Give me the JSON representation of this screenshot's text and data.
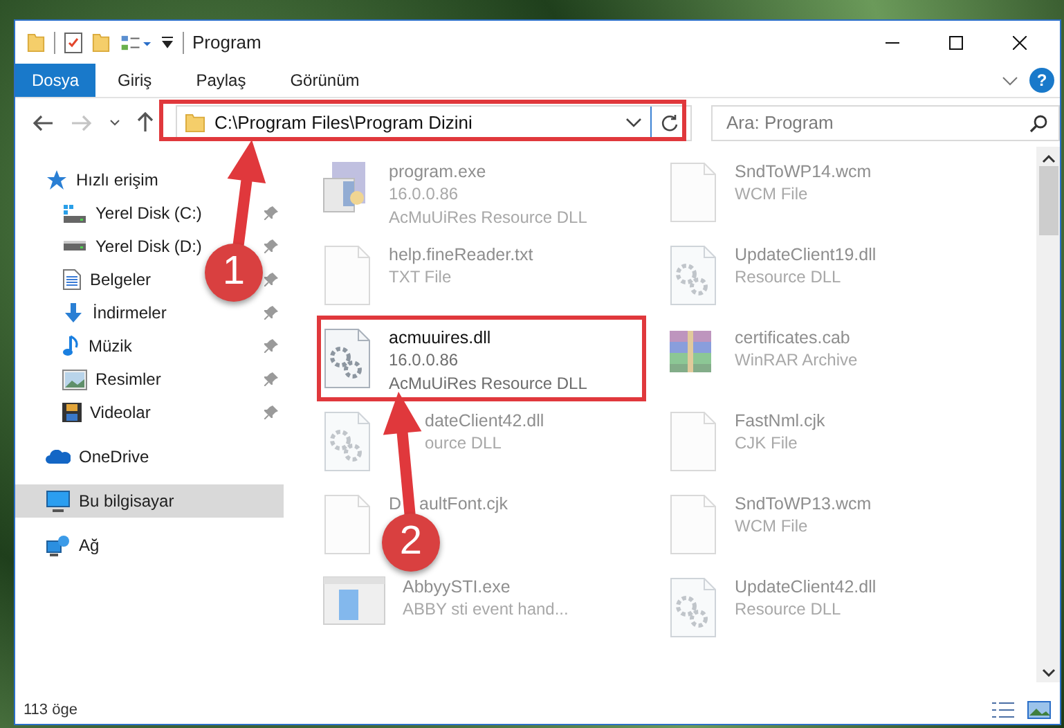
{
  "window": {
    "title": "Program"
  },
  "ribbon": {
    "tabs": [
      {
        "label": "Dosya",
        "kind": "file"
      },
      {
        "label": "Giriş",
        "kind": "tab"
      },
      {
        "label": "Paylaş",
        "kind": "tab"
      },
      {
        "label": "Görünüm",
        "kind": "tab"
      }
    ],
    "help": "?"
  },
  "navigation": {
    "forward": {
      "disabled": true
    }
  },
  "address": {
    "path": "C:\\Program Files\\Program Dizini"
  },
  "search": {
    "placeholder": "Ara: Program"
  },
  "sidebar": {
    "items": [
      {
        "label": "Hızlı erişim",
        "selected": false,
        "children": [
          {
            "label": "Yerel Disk (C:)",
            "pinned": true,
            "selected": false
          },
          {
            "label": "Yerel Disk (D:)",
            "pinned": true,
            "selected": false
          },
          {
            "label": "Belgeler",
            "pinned": true,
            "selected": false
          },
          {
            "label": "İndirmeler",
            "pinned": true,
            "selected": false
          },
          {
            "label": "Müzik",
            "pinned": true,
            "selected": false
          },
          {
            "label": "Resimler",
            "pinned": true,
            "selected": false
          },
          {
            "label": "Videolar",
            "pinned": true,
            "selected": false
          }
        ]
      },
      {
        "label": "OneDrive",
        "selected": false
      },
      {
        "label": "Bu bilgisayar",
        "selected": true
      },
      {
        "label": "Ağ",
        "selected": false
      }
    ]
  },
  "files": [
    {
      "name": "program.exe",
      "details": [
        "16.0.0.86",
        "AcMuUiRes Resource DLL"
      ],
      "kind": "installer",
      "highlighted": false
    },
    {
      "name": "SndToWP14.wcm",
      "details": [
        "WCM File"
      ],
      "kind": "blank",
      "highlighted": false
    },
    {
      "name": "help.fineReader.txt",
      "details": [
        "TXT File"
      ],
      "kind": "blank",
      "highlighted": false
    },
    {
      "name": "UpdateClient19.dll",
      "details": [
        "Resource DLL"
      ],
      "kind": "gears",
      "highlighted": false
    },
    {
      "name": "acmuuires.dll",
      "details": [
        "16.0.0.86",
        "AcMuUiRes Resource DLL"
      ],
      "kind": "gears",
      "highlighted": true
    },
    {
      "name": "certificates.cab",
      "details": [
        "WinRAR Archive"
      ],
      "kind": "archive",
      "highlighted": false
    },
    {
      "name": "dateClient42.dll",
      "details": [
        "ource DLL"
      ],
      "kind": "gears",
      "highlighted": false
    },
    {
      "name": "FastNml.cjk",
      "details": [
        "CJK File"
      ],
      "kind": "blank",
      "highlighted": false
    },
    {
      "name": "D",
      "name_continued": "aultFont.cjk",
      "kind": "blank",
      "highlighted": false
    },
    {
      "name": "SndToWP13.wcm",
      "details": [
        "WCM File"
      ],
      "kind": "blank",
      "highlighted": false
    },
    {
      "name": "AbbyySTI.exe",
      "details": [
        "ABBY sti event hand..."
      ],
      "kind": "app",
      "highlighted": false
    },
    {
      "name": "UpdateClient42.dll",
      "details": [
        "Resource DLL"
      ],
      "kind": "gears",
      "highlighted": false
    }
  ],
  "status_bar": {
    "count": "113 öge"
  },
  "callouts": [
    {
      "number": "1"
    },
    {
      "number": "2"
    }
  ]
}
